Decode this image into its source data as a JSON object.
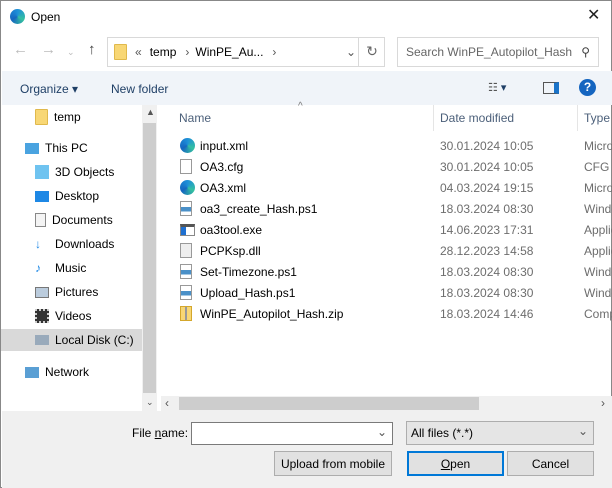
{
  "window": {
    "title": "Open",
    "close_icon": "close-icon"
  },
  "address": {
    "crumb_prefix": "«",
    "crumbs": [
      "temp",
      "WinPE_Au..."
    ],
    "sep": "›"
  },
  "search": {
    "placeholder": "Search WinPE_Autopilot_Hash"
  },
  "toolbar": {
    "organize": "Organize ▾",
    "new_folder": "New folder",
    "help": "?"
  },
  "nav": {
    "items": [
      {
        "label": "temp",
        "icon": "folder-icon"
      },
      {
        "label": "This PC",
        "icon": "pc-icon"
      },
      {
        "label": "3D Objects",
        "icon": "3d-objects-icon"
      },
      {
        "label": "Desktop",
        "icon": "desktop-icon"
      },
      {
        "label": "Documents",
        "icon": "documents-icon"
      },
      {
        "label": "Downloads",
        "icon": "downloads-icon"
      },
      {
        "label": "Music",
        "icon": "music-icon"
      },
      {
        "label": "Pictures",
        "icon": "pictures-icon"
      },
      {
        "label": "Videos",
        "icon": "videos-icon"
      },
      {
        "label": "Local Disk (C:)",
        "icon": "drive-icon",
        "selected": true
      },
      {
        "label": "Network",
        "icon": "network-icon"
      }
    ]
  },
  "columns": {
    "name": "Name",
    "date": "Date modified",
    "type": "Type"
  },
  "files": [
    {
      "name": "input.xml",
      "date": "30.01.2024 10:05",
      "type": "Microsoft Edge HTML Document",
      "icon": "edge-icon"
    },
    {
      "name": "OA3.cfg",
      "date": "30.01.2024 10:05",
      "type": "CFG File",
      "icon": "file-icon"
    },
    {
      "name": "OA3.xml",
      "date": "04.03.2024 19:15",
      "type": "Microsoft Edge HTML Document",
      "icon": "edge-icon"
    },
    {
      "name": "oa3_create_Hash.ps1",
      "date": "18.03.2024 08:30",
      "type": "Windows PowerShell Script",
      "icon": "script-icon"
    },
    {
      "name": "oa3tool.exe",
      "date": "14.06.2023 17:31",
      "type": "Application",
      "icon": "exe-icon"
    },
    {
      "name": "PCPKsp.dll",
      "date": "28.12.2023 14:58",
      "type": "Application extension",
      "icon": "dll-icon"
    },
    {
      "name": "Set-Timezone.ps1",
      "date": "18.03.2024 08:30",
      "type": "Windows PowerShell Script",
      "icon": "script-icon"
    },
    {
      "name": "Upload_Hash.ps1",
      "date": "18.03.2024 08:30",
      "type": "Windows PowerShell Script",
      "icon": "script-icon"
    },
    {
      "name": "WinPE_Autopilot_Hash.zip",
      "date": "18.03.2024 14:46",
      "type": "Compressed (zipped) Folder",
      "icon": "zip-icon"
    }
  ],
  "bottom": {
    "filename_label_pre": "File ",
    "filename_label_u": "n",
    "filename_label_post": "ame:",
    "filename_value": "",
    "filter": "All files (*.*)",
    "upload": "Upload from mobile",
    "open_u": "O",
    "open_rest": "pen",
    "cancel": "Cancel"
  }
}
